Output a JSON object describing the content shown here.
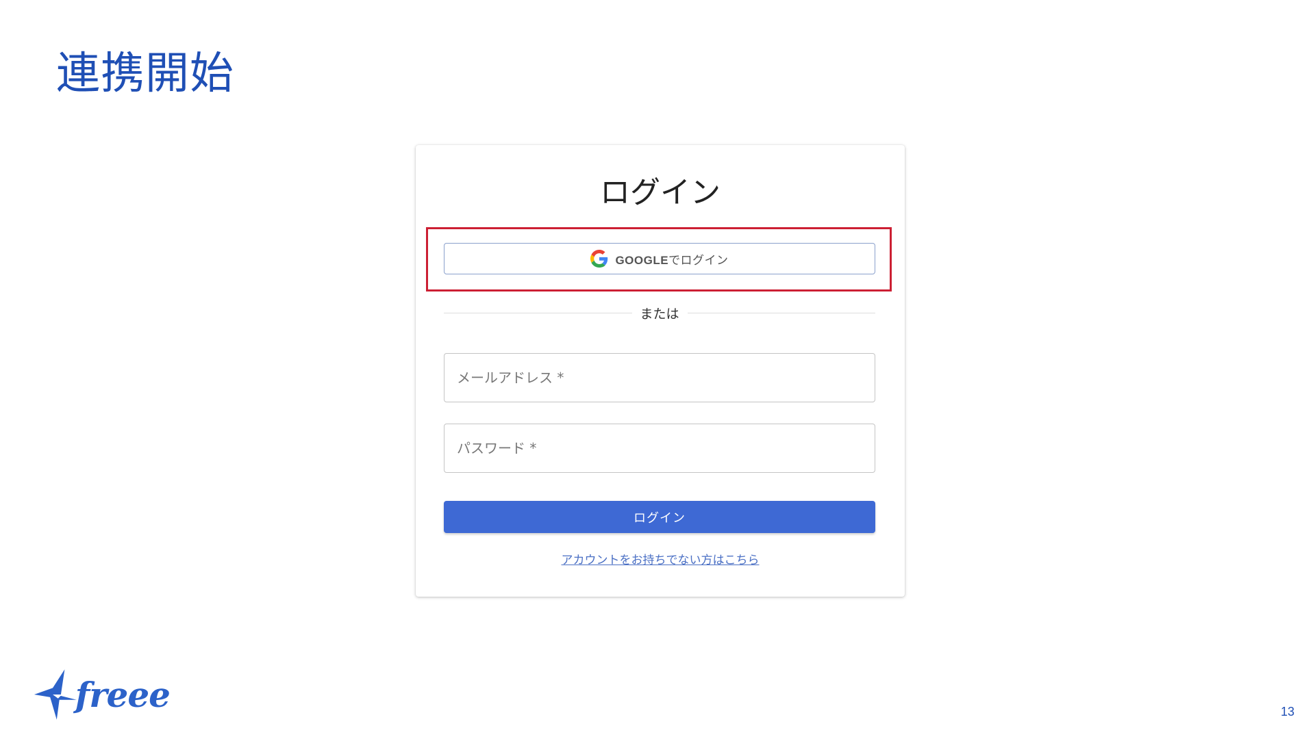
{
  "slide": {
    "title": "連携開始",
    "page_number": "13",
    "logo_text": "freee"
  },
  "login": {
    "title": "ログイン",
    "google_button": {
      "brand": "GOOGLE",
      "suffix": "でログイン"
    },
    "divider_text": "または",
    "email_placeholder": "メールアドレス *",
    "password_placeholder": "パスワード *",
    "submit_label": "ログイン",
    "signup_link": "アカウントをお持ちでない方はこちら"
  },
  "colors": {
    "title": "#1f4fb5",
    "highlight": "#cc1f33",
    "submit": "#3e69d4",
    "link": "#4a6fc4"
  },
  "icons": [
    "google-icon",
    "freee-bird-icon"
  ]
}
